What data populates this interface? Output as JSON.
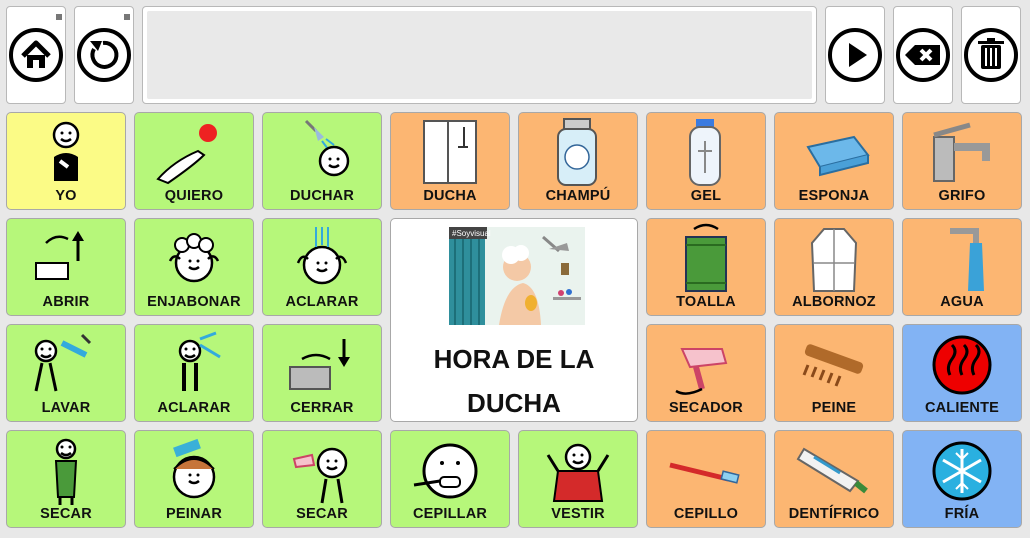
{
  "toolbar": {
    "home": "home-icon",
    "refresh": "refresh-icon",
    "play": "play-icon",
    "backspace": "backspace-icon",
    "clear": "trash-icon"
  },
  "message_bar": {
    "text": ""
  },
  "featured": {
    "title": "HORA DE LA DUCHA",
    "badge": "#Soyvisual"
  },
  "colors": {
    "person": "#fbfb86",
    "verb": "#b6f77a",
    "noun": "#fcb672",
    "adjective": "#82b3f4"
  },
  "grid": [
    {
      "label": "YO",
      "icon": "me-icon",
      "color": "yellow"
    },
    {
      "label": "QUIERO",
      "icon": "want-icon",
      "color": "green"
    },
    {
      "label": "DUCHAR",
      "icon": "shower-person-icon",
      "color": "green"
    },
    {
      "label": "DUCHA",
      "icon": "shower-cabin-icon",
      "color": "orange"
    },
    {
      "label": "CHAMPÚ",
      "icon": "shampoo-bottle-icon",
      "color": "orange"
    },
    {
      "label": "GEL",
      "icon": "gel-bottle-icon",
      "color": "orange"
    },
    {
      "label": "ESPONJA",
      "icon": "sponge-icon",
      "color": "orange"
    },
    {
      "label": "GRIFO",
      "icon": "faucet-icon",
      "color": "orange"
    },
    {
      "label": "ABRIR",
      "icon": "open-tap-icon",
      "color": "green"
    },
    {
      "label": "ENJABONAR",
      "icon": "lather-icon",
      "color": "green"
    },
    {
      "label": "ACLARAR",
      "icon": "rinse-head-icon",
      "color": "green"
    },
    {
      "label": "TOALLA",
      "icon": "towel-icon",
      "color": "orange"
    },
    {
      "label": "ALBORNOZ",
      "icon": "bathrobe-icon",
      "color": "orange"
    },
    {
      "label": "AGUA",
      "icon": "water-icon",
      "color": "orange"
    },
    {
      "label": "LAVAR",
      "icon": "wash-icon",
      "color": "green"
    },
    {
      "label": "ACLARAR",
      "icon": "rinse-body-icon",
      "color": "green"
    },
    {
      "label": "CERRAR",
      "icon": "close-tap-icon",
      "color": "green"
    },
    {
      "label": "SECADOR",
      "icon": "hairdryer-icon",
      "color": "orange"
    },
    {
      "label": "PEINE",
      "icon": "comb-icon",
      "color": "orange"
    },
    {
      "label": "CALIENTE",
      "icon": "hot-icon",
      "color": "blue"
    },
    {
      "label": "SECAR",
      "icon": "dry-body-icon",
      "color": "green"
    },
    {
      "label": "PEINAR",
      "icon": "comb-hair-icon",
      "color": "green"
    },
    {
      "label": "SECAR",
      "icon": "dry-hair-icon",
      "color": "green"
    },
    {
      "label": "CEPILLAR",
      "icon": "brush-teeth-icon",
      "color": "green"
    },
    {
      "label": "VESTIR",
      "icon": "dress-icon",
      "color": "green"
    },
    {
      "label": "CEPILLO",
      "icon": "toothbrush-icon",
      "color": "orange"
    },
    {
      "label": "DENTÍFRICO",
      "icon": "toothpaste-icon",
      "color": "orange"
    },
    {
      "label": "FRÍA",
      "icon": "cold-icon",
      "color": "blue"
    }
  ]
}
